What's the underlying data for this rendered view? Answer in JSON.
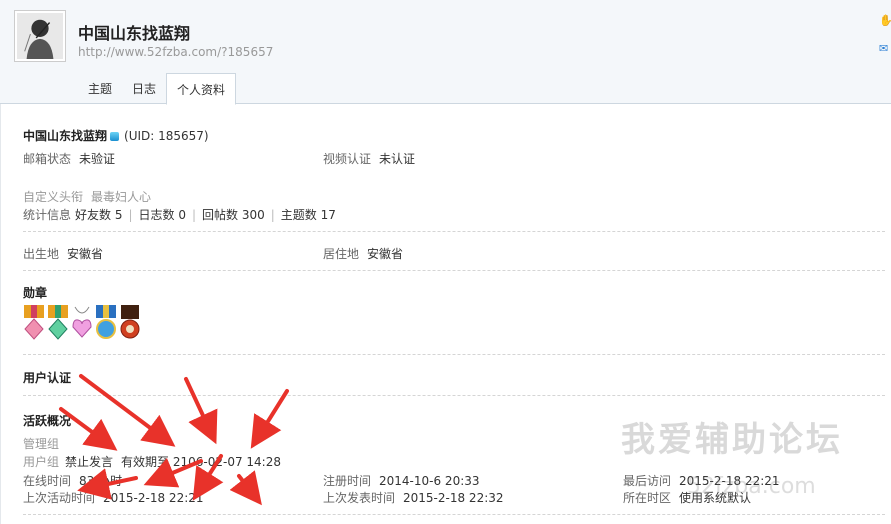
{
  "profile": {
    "name": "中国山东找蓝翔",
    "url": "http://www.52fzba.com/?185657"
  },
  "tabs": [
    "主题",
    "日志",
    "个人资料"
  ],
  "info": {
    "name": "中国山东找蓝翔",
    "uid": "(UID: 185657)",
    "email_label": "邮箱状态",
    "email_value": "未验证",
    "video_label": "视频认证",
    "video_value": "未认证",
    "title_label": "自定义头衔",
    "title_value": "最毒妇人心",
    "stats_label": "统计信息",
    "stats": [
      "好友数 5",
      "日志数 0",
      "回帖数 300",
      "主题数 17"
    ],
    "birthplace_label": "出生地",
    "birthplace_value": "安徽省",
    "residence_label": "居住地",
    "residence_value": "安徽省",
    "medals_label": "勋章",
    "verify_label": "用户认证",
    "activity_label": "活跃概况",
    "admin_group_label": "管理组",
    "user_group_label": "用户组",
    "user_group_value": "禁止发言",
    "expiry": "有效期至 2106-02-07 14:28",
    "online_label": "在线时间",
    "online_value": "83 小时",
    "register_label": "注册时间",
    "register_value": "2014-10-6 20:33",
    "last_visit_label": "最后访问",
    "last_visit_value": "2015-2-18 22:21",
    "last_active_label": "上次活动时间",
    "last_active_value": "2015-2-18 22:21",
    "last_post_label": "上次发表时间",
    "last_post_value": "2015-2-18 22:32",
    "timezone_label": "所在时区",
    "timezone_value": "使用系统默认"
  },
  "watermark": "我爱辅助论坛",
  "watermark_url": "52fzba.com",
  "colors": {
    "arrow": "#e8322a",
    "accent": "#1b8fd0"
  }
}
